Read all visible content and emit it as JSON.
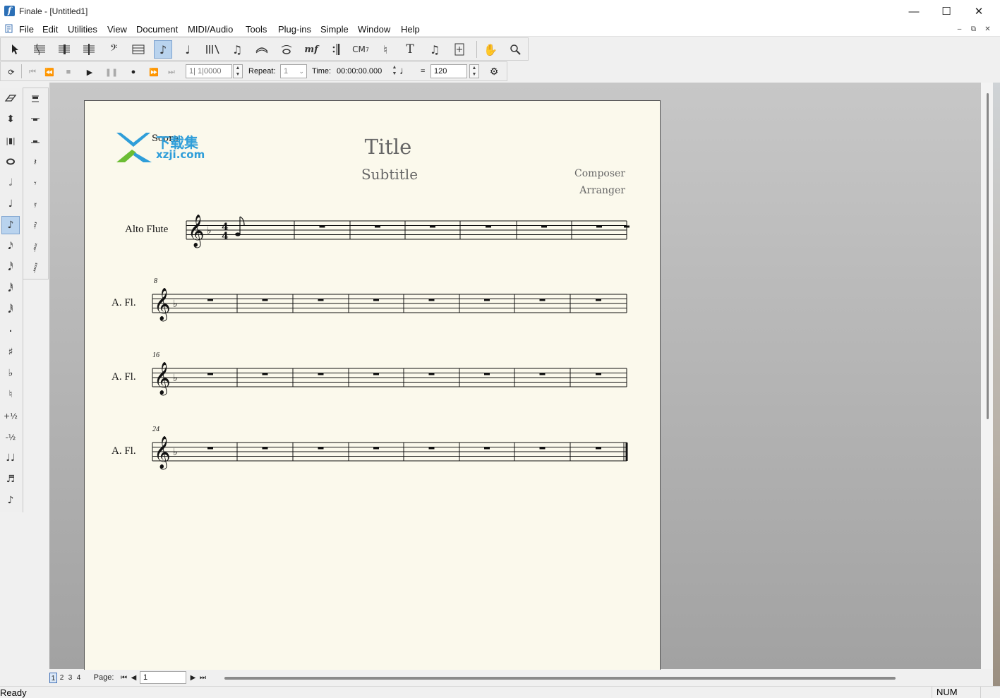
{
  "window": {
    "title": "Finale - [Untitled1]"
  },
  "menu": [
    "File",
    "Edit",
    "Utilities",
    "View",
    "Document",
    "MIDI/Audio",
    "Tools",
    "Plug-ins",
    "Simple",
    "Window",
    "Help"
  ],
  "main_toolbar": {
    "tools": [
      "selection-tool",
      "staff-tool",
      "simple-entry-tool",
      "speedy-entry-tool",
      "clef-tool",
      "key-signature-tool",
      "simple-note-tool",
      "rest-tool",
      "articulation-tool",
      "tuplet-tool",
      "smart-shape-tool",
      "tie-tool",
      "expression-tool",
      "repeat-tool",
      "chord-tool",
      "lyrics-tool",
      "text-tool",
      "measure-tool",
      "resize-tool",
      "hand-grabber-tool",
      "zoom-tool"
    ],
    "expression_label": "mf",
    "chord_label": "CM",
    "text_label": "T"
  },
  "playback": {
    "counter": "1| 1|0000",
    "repeat_label": "Repeat:",
    "repeat_value": "1",
    "time_label": "Time:",
    "time_value": "00:00:00.000",
    "equals": "=",
    "tempo": "120"
  },
  "left_palette": [
    "eraser-icon",
    "tilt-icon",
    "measure-rest-icon",
    "whole-note-icon",
    "half-note-icon",
    "quarter-note-icon",
    "eighth-note-icon",
    "sixteenth-note-icon",
    "thirty-second-note-icon",
    "sixty-fourth-note-icon",
    "one-twenty-eighth-note-icon",
    "dot-icon",
    "sharp-icon",
    "flat-icon",
    "natural-icon",
    "half-step-up-icon",
    "half-step-down-icon",
    "tie-icon",
    "tuplet-icon",
    "grace-note-icon"
  ],
  "left_palette_labels": {
    "half_up": "+½",
    "half_down": "-½"
  },
  "score": {
    "header_label": "Score",
    "title": "Title",
    "subtitle": "Subtitle",
    "composer": "Composer",
    "arranger": "Arranger",
    "staves": [
      {
        "name": "Alto Flute",
        "measure_number": ""
      },
      {
        "name": "A. Fl.",
        "measure_number": "8"
      },
      {
        "name": "A. Fl.",
        "measure_number": "16"
      },
      {
        "name": "A. Fl.",
        "measure_number": "24"
      }
    ]
  },
  "watermark": {
    "line1": "下载集",
    "line2": "xzji.com"
  },
  "bottom": {
    "page_tabs": [
      "1",
      "2",
      "3",
      "4"
    ],
    "page_label": "Page:",
    "page_value": "1"
  },
  "status": {
    "left": "Ready",
    "right": "NUM"
  },
  "colors": {
    "accent": "#b9d3ee",
    "page": "#fbf9ec",
    "desk": "#a9a9a9"
  }
}
